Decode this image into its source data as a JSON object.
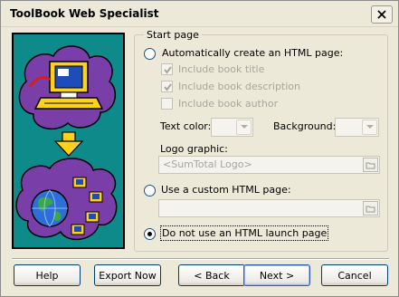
{
  "window": {
    "title": "ToolBook Web Specialist"
  },
  "start_page": {
    "group_title": "Start page",
    "auto_create": {
      "label": "Automatically create an HTML page:",
      "options": [
        {
          "label": "Include book title",
          "checked": true
        },
        {
          "label": "Include book description",
          "checked": true
        },
        {
          "label": "Include book author",
          "checked": false
        }
      ],
      "text_color_label": "Text color:",
      "background_label": "Background:",
      "logo_label": "Logo graphic:",
      "logo_value": "<SumTotal Logo>"
    },
    "custom": {
      "label": "Use a custom HTML page:",
      "value": ""
    },
    "no_launch": {
      "label": "Do not use an HTML launch page",
      "selected": true
    }
  },
  "buttons": {
    "help": "Help",
    "export": "Export Now",
    "back": "< Back",
    "next": "Next >",
    "cancel": "Cancel"
  },
  "icons": [
    "close-icon",
    "computer-illustration-icon",
    "arrow-down-icon",
    "globe-network-icon",
    "chevron-down-icon",
    "browse-icon"
  ]
}
